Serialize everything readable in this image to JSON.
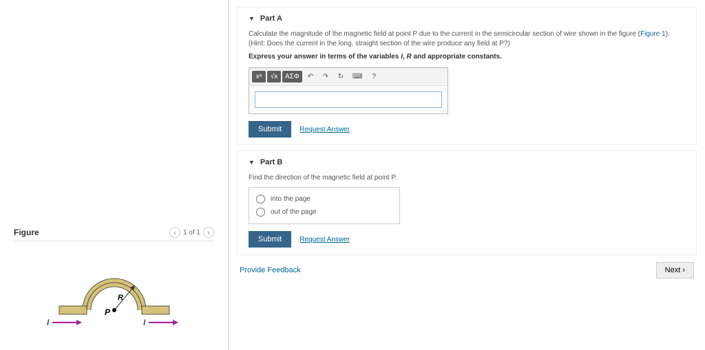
{
  "figure": {
    "title": "Figure",
    "nav_label": "1 of 1"
  },
  "partA": {
    "title": "Part A",
    "prompt_pre": "Calculate the magnitude of the magnetic field at point P due to the current in the semicircular section of wire shown in the figure (",
    "figure_link": "Figure 1",
    "prompt_post": "). (Hint: Does the current in the long, straight section of the wire produce any field at P?)",
    "instruction_pre": "Express your answer in terms of the variables ",
    "var1": "I",
    "sep": ", ",
    "var2": "R",
    "instruction_post": " and appropriate constants.",
    "toolbar": {
      "btn1": "xᵃ",
      "btn2": "√x",
      "btn3": "ΑΣΦ",
      "undo": "↶",
      "redo": "↷",
      "reset": "↻",
      "keyboard": "⌨",
      "help": "?"
    },
    "submit": "Submit",
    "request": "Request Answer"
  },
  "partB": {
    "title": "Part B",
    "prompt": "Find the direction of the magnetic field at point P.",
    "opt1": "into the page",
    "opt2": "out of the page",
    "submit": "Submit",
    "request": "Request Answer"
  },
  "footer": {
    "feedback": "Provide Feedback",
    "next": "Next ›"
  },
  "diagram": {
    "I_left": "I",
    "I_right": "I",
    "R": "R",
    "P": "P"
  }
}
